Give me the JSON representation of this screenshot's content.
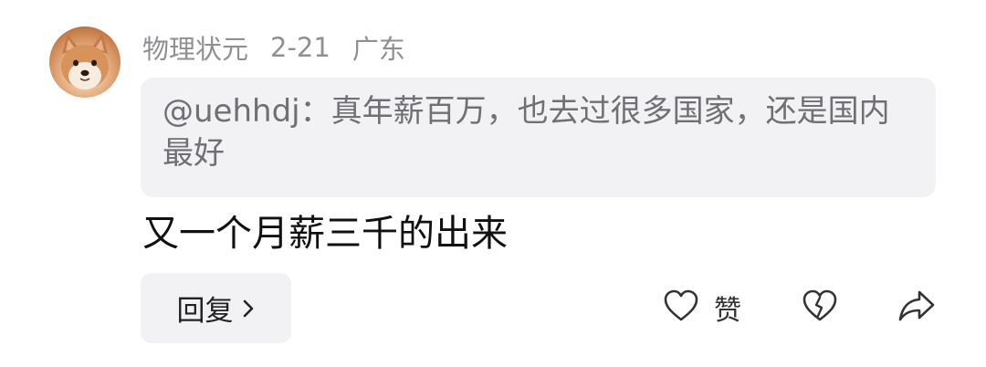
{
  "comment": {
    "author": {
      "name": "物理状元",
      "avatar_icon": "shiba-dog-avatar"
    },
    "date": "2-21",
    "location": "广东",
    "quote": "@uehhdj：真年薪百万，也去过很多国家，还是国内最好",
    "text": "又一个月薪三千的出来",
    "actions": {
      "reply_label": "回复",
      "reply_icon": "chevron-right-icon",
      "like_label": "赞",
      "like_icon": "heart-outline-icon",
      "dislike_icon": "broken-heart-icon",
      "share_icon": "share-arrow-icon"
    }
  },
  "colors": {
    "meta_text": "#8f8f94",
    "quote_bg": "#f2f2f4",
    "quote_text": "#6f6f74",
    "body_text": "#111111",
    "icon": "#333333"
  }
}
